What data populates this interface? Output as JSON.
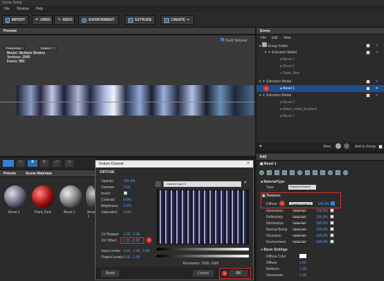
{
  "window": {
    "title": "Scene Setup"
  },
  "menu": [
    "File",
    "Window",
    "Help"
  ],
  "toolbar": {
    "import": "IMPORT",
    "undo": "UNDO",
    "redo": "REDO",
    "environment": "ENVIRONMENT",
    "extrude": "EXTRUDE",
    "create": "CREATE"
  },
  "preview": {
    "title": "Preview",
    "draft": "Draft Textures",
    "view": "Perspective",
    "shading": "Shaded",
    "stats": [
      {
        "k": "Model:",
        "v": "Multiple Models"
      },
      {
        "k": "Vertices:",
        "v": "2940"
      },
      {
        "k": "Faces:",
        "v": "982"
      }
    ]
  },
  "materials": {
    "tabs": [
      "Presets",
      "Scene Materials"
    ],
    "items": [
      "Bevel 1",
      "Paint_Red",
      "Bevel 1",
      "Bevel 1"
    ]
  },
  "scene": {
    "title": "Scene",
    "menu": [
      "File",
      "Edit",
      "View"
    ],
    "tree": [
      {
        "label": "Group Folder"
      },
      {
        "label": "Extrusion Model"
      },
      {
        "label": "Bevel 1"
      },
      {
        "label": "Bevel 1"
      },
      {
        "label": "Paint_Red"
      },
      {
        "label": "Extrusion Model"
      },
      {
        "label": "Bevel 1"
      },
      {
        "label": "Extrusion Model"
      },
      {
        "label": "Bevel 1"
      },
      {
        "label": "Asian_metal_brushed"
      },
      {
        "label": "Bevel 1"
      }
    ],
    "view": "View:",
    "add_group": "Add to Group"
  },
  "edit": {
    "title": "Edit",
    "name": "Bevel 1",
    "material_type": "MaterialType",
    "type_label": "Type",
    "type_value": "Physical Shaded",
    "textures_title": "Textures",
    "textures": [
      {
        "name": "Diffuse",
        "slot": "Custom Layer 3",
        "pct": "100.0%"
      },
      {
        "name": "Glossiness",
        "slot": "None Set",
        "pct": "100.0%"
      },
      {
        "name": "Reflectivity",
        "slot": "None Set",
        "pct": "100.0%"
      },
      {
        "name": "Illumination",
        "slot": "None Set",
        "pct": "100.0%"
      },
      {
        "name": "Normal Bump",
        "slot": "None Set",
        "pct": "100.0%"
      },
      {
        "name": "Occlusion",
        "slot": "None Set",
        "pct": "100.0%"
      },
      {
        "name": "Environment",
        "slot": "None Set",
        "pct": "100.0%"
      }
    ],
    "basic_title": "Basic Settings",
    "basic": [
      {
        "name": "Diffuse Color",
        "v": ""
      },
      {
        "name": "Diffuse",
        "v": "1.00"
      },
      {
        "name": "Ambient",
        "v": "1.00"
      },
      {
        "name": "Glossiness",
        "v": "1.00"
      }
    ]
  },
  "dialog": {
    "title": "Texture Channel",
    "section": "DIFFUSE",
    "layer": "Custom Layer 3",
    "props": [
      {
        "k": "Opacity:",
        "v": "100.0%"
      },
      {
        "k": "Gamma:",
        "v": "2.60"
      },
      {
        "k": "Invert:",
        "v": ""
      },
      {
        "k": "Contrast:",
        "v": "0.0%"
      },
      {
        "k": "Brightness:",
        "v": "0.0%"
      },
      {
        "k": "Saturation:",
        "v": "0.0%"
      }
    ],
    "uv_repeat": {
      "k": "UV Repeat:",
      "v": "1.00 , 2.96"
    },
    "uv_offset": {
      "k": "UV Offset:",
      "v": "1.11 , 0.00"
    },
    "input_levels": {
      "k": "Input Levels:",
      "v": "0.00 , 1.00 , 1.00"
    },
    "output_levels": {
      "k": "Output Levels:",
      "v": "0.00 , 1.00"
    },
    "resolution": "Resolution: 7000, 1685",
    "reset": "Reset",
    "cancel": "Cancel",
    "ok": "OK"
  },
  "badges": {
    "b1": "1",
    "b2": "2",
    "b3": "3",
    "b4": "4"
  }
}
